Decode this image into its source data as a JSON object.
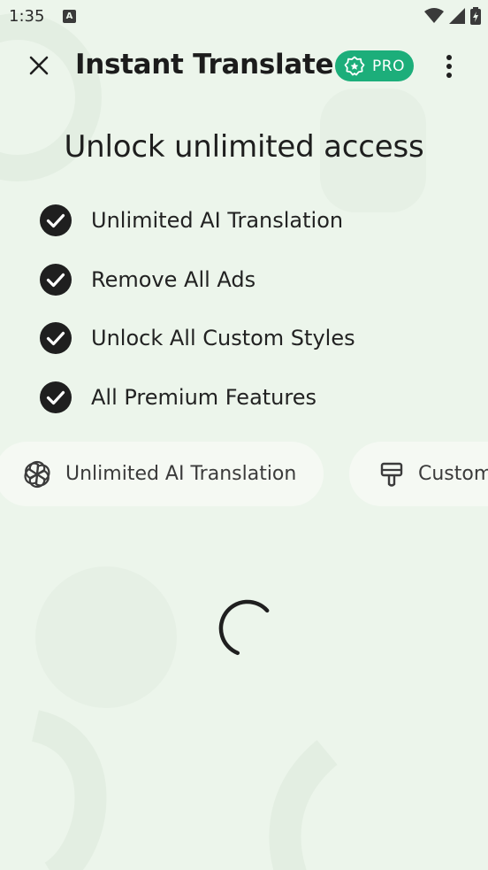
{
  "status_bar": {
    "time": "1:35",
    "notification_icon": "A"
  },
  "toolbar": {
    "title": "Instant Translate",
    "pro_badge": "PRO"
  },
  "headline": "Unlock unlimited access",
  "features": [
    {
      "label": "Unlimited AI Translation"
    },
    {
      "label": "Remove All Ads"
    },
    {
      "label": "Unlock All Custom Styles"
    },
    {
      "label": "All Premium Features"
    }
  ],
  "chips": [
    {
      "label": "Unlimited AI Translation",
      "icon": "ai-knot-icon"
    },
    {
      "label": "Custom Styles",
      "icon": "paint-brush-icon"
    }
  ],
  "colors": {
    "background": "#ecf5eb",
    "accent": "#1cae7a",
    "chip_background": "#f5f9f3",
    "text": "#1f1f1f"
  }
}
